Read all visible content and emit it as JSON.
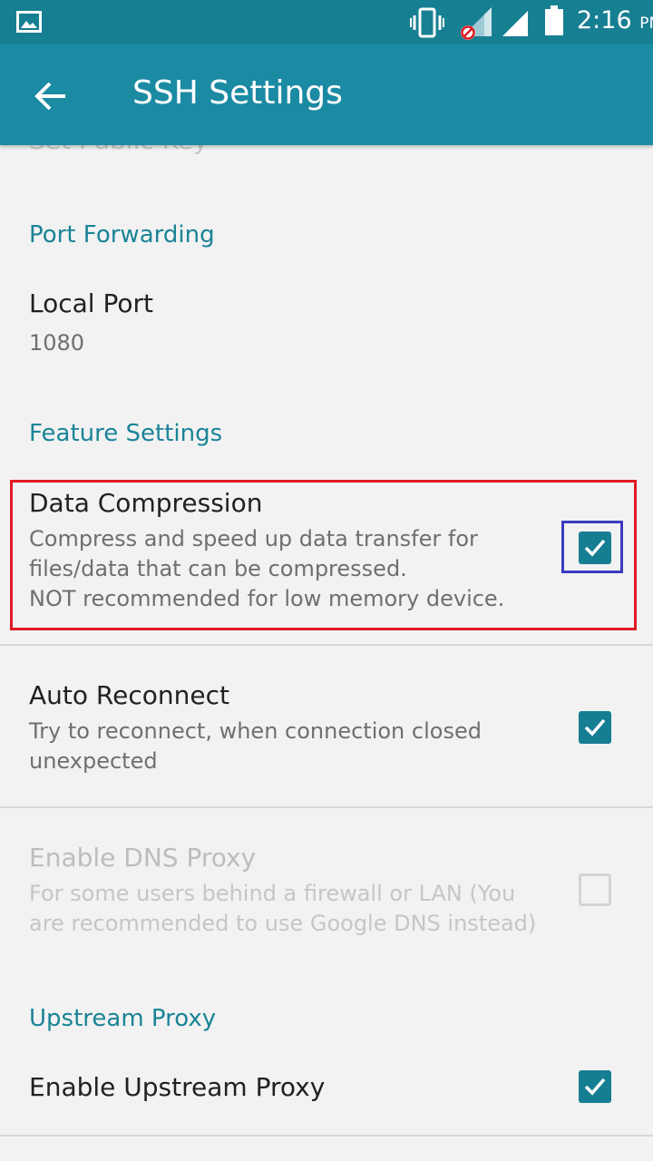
{
  "status_bar": {
    "time": "2:16",
    "ampm": "PM"
  },
  "app_bar": {
    "title": "SSH Settings"
  },
  "cutoff_item": "Set Public Key",
  "sections": {
    "port_forwarding": "Port Forwarding",
    "feature_settings": "Feature Settings",
    "upstream_proxy": "Upstream Proxy"
  },
  "prefs": {
    "local_port": {
      "title": "Local Port",
      "summary": "1080"
    },
    "data_compression": {
      "title": "Data Compression",
      "summary_lines": [
        "Compress and speed up data transfer for",
        "files/data that can be compressed.",
        "NOT recommended for low memory device."
      ],
      "checked": true
    },
    "auto_reconnect": {
      "title": "Auto Reconnect",
      "summary_lines": [
        "Try to reconnect, when connection closed",
        "unexpected"
      ],
      "checked": true
    },
    "enable_dns_proxy": {
      "title": "Enable DNS Proxy",
      "summary_lines": [
        "For some users behind a firewall or LAN (You",
        "are recommended to use Google DNS instead)"
      ],
      "checked": false,
      "enabled": false
    },
    "enable_upstream_proxy": {
      "title": "Enable Upstream Proxy",
      "checked": true
    }
  },
  "colors": {
    "status_bar": "#177f92",
    "app_bar": "#1b8aa3",
    "accent": "#1a8496",
    "checkbox": "#167e93",
    "highlight_red": "#e01b24",
    "highlight_blue": "#3b3bc2"
  },
  "icons": [
    "picture-icon",
    "vibrate-icon",
    "signal-no-data-icon",
    "signal-icon",
    "battery-icon",
    "back-arrow-icon",
    "checkmark-icon"
  ]
}
